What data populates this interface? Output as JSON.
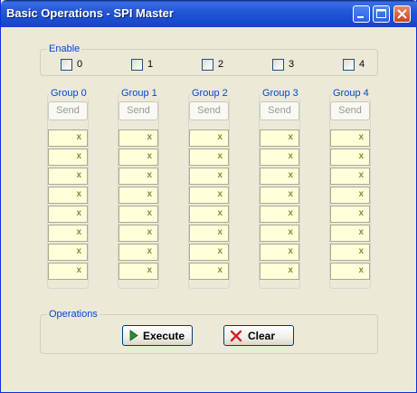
{
  "window": {
    "title": "Basic Operations - SPI Master"
  },
  "enable": {
    "label": "Enable",
    "options": [
      {
        "label": "0",
        "checked": false
      },
      {
        "label": "1",
        "checked": false
      },
      {
        "label": "2",
        "checked": false
      },
      {
        "label": "3",
        "checked": false
      },
      {
        "label": "4",
        "checked": false
      }
    ]
  },
  "groups": [
    {
      "label": "Group 0",
      "send_label": "Send",
      "cells": [
        "x",
        "x",
        "x",
        "x",
        "x",
        "x",
        "x",
        "x"
      ]
    },
    {
      "label": "Group 1",
      "send_label": "Send",
      "cells": [
        "x",
        "x",
        "x",
        "x",
        "x",
        "x",
        "x",
        "x"
      ]
    },
    {
      "label": "Group 2",
      "send_label": "Send",
      "cells": [
        "x",
        "x",
        "x",
        "x",
        "x",
        "x",
        "x",
        "x"
      ]
    },
    {
      "label": "Group 3",
      "send_label": "Send",
      "cells": [
        "x",
        "x",
        "x",
        "x",
        "x",
        "x",
        "x",
        "x"
      ]
    },
    {
      "label": "Group 4",
      "send_label": "Send",
      "cells": [
        "x",
        "x",
        "x",
        "x",
        "x",
        "x",
        "x",
        "x"
      ]
    }
  ],
  "operations": {
    "label": "Operations",
    "execute_label": "Execute",
    "clear_label": "Clear"
  },
  "colors": {
    "title_bar": "#2557d6",
    "group_label": "#0046d5",
    "cell_bg": "#ffffd9",
    "close_button": "#c6471e"
  }
}
